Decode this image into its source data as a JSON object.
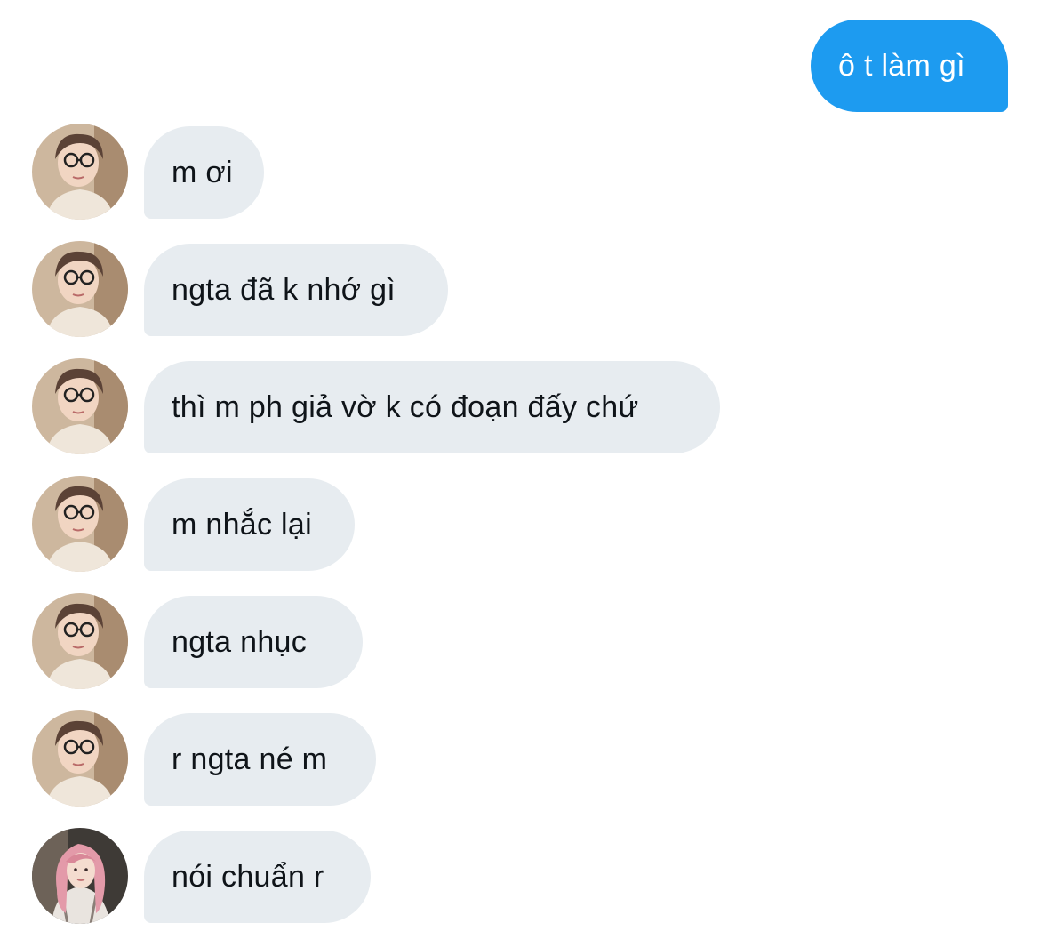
{
  "messages": [
    {
      "direction": "sent",
      "text": "ô t làm gì"
    },
    {
      "direction": "received",
      "sender_avatar": "avatar-girl-glasses",
      "text": "m ơi"
    },
    {
      "direction": "received",
      "sender_avatar": "avatar-girl-glasses",
      "text": "ngta đã k nhớ gì"
    },
    {
      "direction": "received",
      "sender_avatar": "avatar-girl-glasses",
      "text": "thì m ph giả vờ k có đoạn đấy chứ"
    },
    {
      "direction": "received",
      "sender_avatar": "avatar-girl-glasses",
      "text": "m nhắc lại"
    },
    {
      "direction": "received",
      "sender_avatar": "avatar-girl-glasses",
      "text": "ngta nhục"
    },
    {
      "direction": "received",
      "sender_avatar": "avatar-girl-glasses",
      "text": "r ngta né m"
    },
    {
      "direction": "received",
      "sender_avatar": "avatar-girl-pink-hair",
      "text": "nói chuẩn r"
    }
  ],
  "colors": {
    "sent_bubble": "#1d9bf0",
    "received_bubble": "#e7ecf0",
    "received_text": "#0f1419",
    "sent_text": "#ffffff"
  }
}
